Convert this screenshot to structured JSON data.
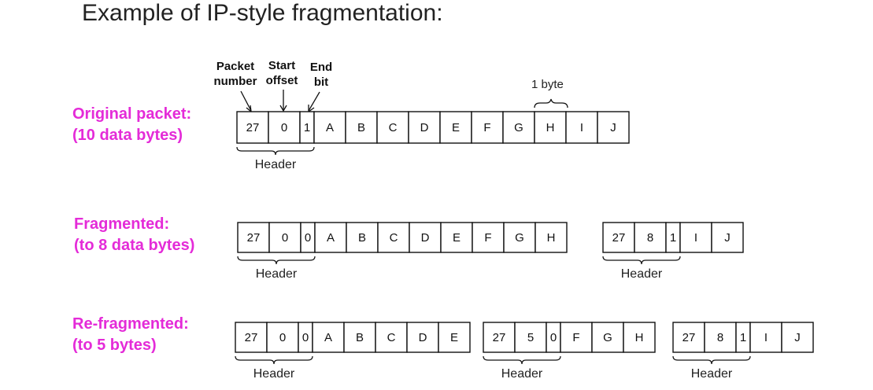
{
  "title": "Example of IP-style fragmentation:",
  "annotations": {
    "packet_number": [
      "Packet",
      "number"
    ],
    "start_offset": [
      "Start",
      "offset"
    ],
    "end_bit": [
      "End",
      "bit"
    ],
    "one_byte": "1 byte"
  },
  "header_label": "Header",
  "rows": [
    {
      "label": [
        "Original packet:",
        "(10 data bytes)"
      ],
      "packets": [
        {
          "number": "27",
          "offset": "0",
          "end": "1",
          "data": [
            "A",
            "B",
            "C",
            "D",
            "E",
            "F",
            "G",
            "H",
            "I",
            "J"
          ]
        }
      ]
    },
    {
      "label": [
        "Fragmented:",
        "(to 8 data bytes)"
      ],
      "packets": [
        {
          "number": "27",
          "offset": "0",
          "end": "0",
          "data": [
            "A",
            "B",
            "C",
            "D",
            "E",
            "F",
            "G",
            "H"
          ]
        },
        {
          "number": "27",
          "offset": "8",
          "end": "1",
          "data": [
            "I",
            "J"
          ]
        }
      ]
    },
    {
      "label": [
        "Re-fragmented:",
        "(to 5 bytes)"
      ],
      "packets": [
        {
          "number": "27",
          "offset": "0",
          "end": "0",
          "data": [
            "A",
            "B",
            "C",
            "D",
            "E"
          ]
        },
        {
          "number": "27",
          "offset": "5",
          "end": "0",
          "data": [
            "F",
            "G",
            "H"
          ]
        },
        {
          "number": "27",
          "offset": "8",
          "end": "1",
          "data": [
            "I",
            "J"
          ]
        }
      ]
    }
  ]
}
